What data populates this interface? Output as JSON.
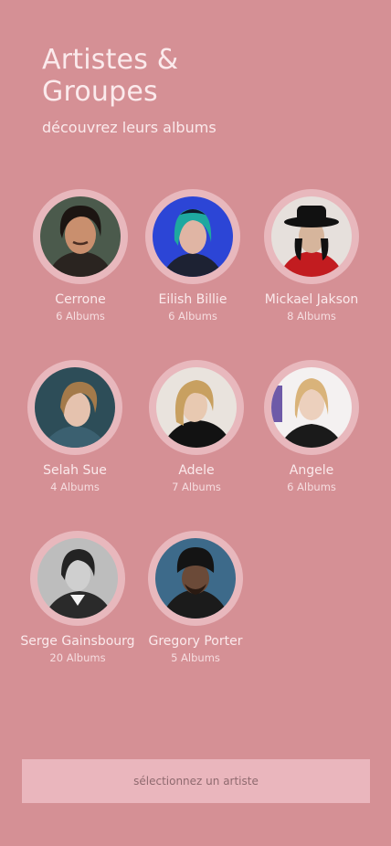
{
  "header": {
    "title_line1": "Artistes &",
    "title_line2": "Groupes",
    "subtitle": "découvrez leurs albums"
  },
  "artists": [
    {
      "name": "Cerrone",
      "count": "6 Albums",
      "icon": "portrait-cerrone-icon"
    },
    {
      "name": "Eilish Billie",
      "count": "6 Albums",
      "icon": "portrait-eilish-billie-icon"
    },
    {
      "name": "Mickael Jakson",
      "count": "8 Albums",
      "icon": "portrait-mickael-jakson-icon"
    },
    {
      "name": "Selah Sue",
      "count": "4 Albums",
      "icon": "portrait-selah-sue-icon"
    },
    {
      "name": "Adele",
      "count": "7 Albums",
      "icon": "portrait-adele-icon"
    },
    {
      "name": "Angele",
      "count": "6 Albums",
      "icon": "portrait-angele-icon"
    },
    {
      "name": "Serge Gainsbourg",
      "count": "20 Albums",
      "icon": "portrait-serge-gainsbourg-icon"
    },
    {
      "name": "Gregory Porter",
      "count": "5 Albums",
      "icon": "portrait-gregory-porter-icon"
    }
  ],
  "footer": {
    "button_label": "sélectionnez un artiste"
  },
  "colors": {
    "background": "#d59095",
    "ring": "#e8b8bd",
    "text": "#fbeaec",
    "button": "#eab6bd"
  }
}
